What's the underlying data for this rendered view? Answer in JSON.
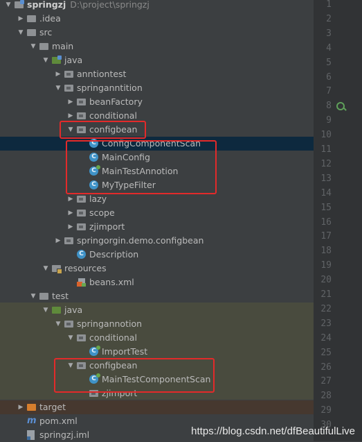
{
  "project": {
    "name": "springzj",
    "path": "D:\\project\\springzj"
  },
  "tree": [
    {
      "label": "springzj",
      "path": "D:\\project\\springzj",
      "icon": "project-folder-icon",
      "arrow": "down",
      "indent": 0,
      "root": true
    },
    {
      "label": ".idea",
      "icon": "folder-icon",
      "arrow": "right",
      "indent": 1
    },
    {
      "label": "src",
      "icon": "folder-icon",
      "arrow": "down",
      "indent": 1
    },
    {
      "label": "main",
      "icon": "folder-icon",
      "arrow": "down",
      "indent": 2
    },
    {
      "label": "java",
      "icon": "source-folder-icon",
      "arrow": "down",
      "indent": 3
    },
    {
      "label": "anntiontest",
      "icon": "package-icon",
      "arrow": "right",
      "indent": 4
    },
    {
      "label": "springanntition",
      "icon": "package-icon",
      "arrow": "down",
      "indent": 4
    },
    {
      "label": "beanFactory",
      "icon": "package-icon",
      "arrow": "right",
      "indent": 5
    },
    {
      "label": "conditional",
      "icon": "package-icon",
      "arrow": "right",
      "indent": 5
    },
    {
      "label": "configbean",
      "icon": "package-icon",
      "arrow": "down",
      "indent": 5
    },
    {
      "label": "ConfigComponentScan",
      "icon": "class-icon",
      "arrow": "",
      "indent": 6,
      "selected": true
    },
    {
      "label": "MainConfig",
      "icon": "class-icon",
      "arrow": "",
      "indent": 6
    },
    {
      "label": "MainTestAnnotion",
      "icon": "test-class-icon",
      "arrow": "",
      "indent": 6
    },
    {
      "label": "MyTypeFilter",
      "icon": "class-icon",
      "arrow": "",
      "indent": 6
    },
    {
      "label": "lazy",
      "icon": "package-icon",
      "arrow": "right",
      "indent": 5
    },
    {
      "label": "scope",
      "icon": "package-icon",
      "arrow": "right",
      "indent": 5
    },
    {
      "label": "zjimport",
      "icon": "package-icon",
      "arrow": "right",
      "indent": 5
    },
    {
      "label": "springorgin.demo.configbean",
      "icon": "package-icon",
      "arrow": "right",
      "indent": 4
    },
    {
      "label": "Description",
      "icon": "class-icon",
      "arrow": "",
      "indent": 5
    },
    {
      "label": "resources",
      "icon": "resources-folder-icon",
      "arrow": "down",
      "indent": 3
    },
    {
      "label": "beans.xml",
      "icon": "xml-file-icon",
      "arrow": "",
      "indent": 5
    },
    {
      "label": "test",
      "icon": "folder-icon",
      "arrow": "down",
      "indent": 2
    },
    {
      "label": "java",
      "icon": "test-source-folder-icon",
      "arrow": "down",
      "indent": 3
    },
    {
      "label": "springannotion",
      "icon": "package-icon",
      "arrow": "down",
      "indent": 4
    },
    {
      "label": "conditional",
      "icon": "package-icon",
      "arrow": "down",
      "indent": 5
    },
    {
      "label": "ImportTest",
      "icon": "test-class-icon",
      "arrow": "",
      "indent": 6
    },
    {
      "label": "configbean",
      "icon": "package-icon",
      "arrow": "down",
      "indent": 5
    },
    {
      "label": "MainTestComponentScan",
      "icon": "test-class-icon",
      "arrow": "",
      "indent": 6
    },
    {
      "label": "zjimport",
      "icon": "package-icon",
      "arrow": "",
      "indent": 6
    },
    {
      "label": "target",
      "icon": "excluded-folder-icon",
      "arrow": "right",
      "indent": 1,
      "excluded": true
    },
    {
      "label": "pom.xml",
      "icon": "maven-pom-icon",
      "arrow": "",
      "indent": 1
    },
    {
      "label": "springzj.iml",
      "icon": "module-file-icon",
      "arrow": "",
      "indent": 1
    }
  ],
  "line_numbers": [
    "1",
    "2",
    "3",
    "4",
    "5",
    "6",
    "7",
    "8",
    "9",
    "10",
    "11",
    "12",
    "13",
    "14",
    "15",
    "16",
    "17",
    "18",
    "19",
    "20",
    "21",
    "22",
    "23",
    "24",
    "25",
    "26",
    "27",
    "28",
    "29",
    "30"
  ],
  "gutter_marker_line": "9",
  "watermark": "https://blog.csdn.net/dfBeautifulLive",
  "colors": {
    "background": "#3c3f41",
    "selected": "#0d293e",
    "highlight_box": "#e32a2a",
    "test_bg": "#494b3e"
  }
}
